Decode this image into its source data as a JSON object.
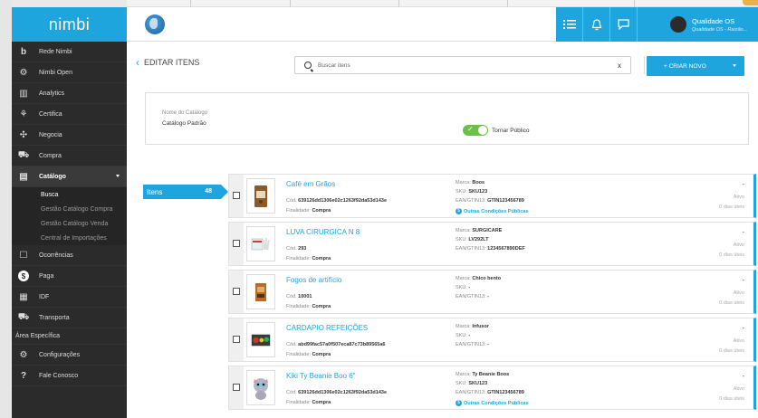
{
  "brand": "nimbi",
  "sidebar": {
    "items": [
      {
        "icon": "nimbi-b-icon",
        "glyph": "b",
        "label": "Rede Nimbi"
      },
      {
        "icon": "gear-icon",
        "glyph": "⚙",
        "label": "Nimbi Open"
      },
      {
        "icon": "analytics-icon",
        "glyph": "▥",
        "label": "Analytics"
      },
      {
        "icon": "certifica-icon",
        "glyph": "⚘",
        "label": "Certifica"
      },
      {
        "icon": "negocia-icon",
        "glyph": "✣",
        "label": "Negocia"
      },
      {
        "icon": "cart-icon",
        "glyph": "⛟",
        "label": "Compra"
      }
    ],
    "catalog": {
      "label": "Catálogo",
      "icon": "books-icon",
      "glyph": "▤"
    },
    "sub_items": [
      "Busca",
      "Gestão Catálogo Compra",
      "Gestão Catálogo Venda",
      "Central de Importações"
    ],
    "items2": [
      {
        "icon": "ocorrencias-icon",
        "glyph": "☐",
        "label": "Ocorrências"
      },
      {
        "icon": "dollar-icon",
        "glyph": "$",
        "label": "Paga"
      },
      {
        "icon": "idf-icon",
        "glyph": "▦",
        "label": "IDF"
      },
      {
        "icon": "truck-icon",
        "glyph": "⛟",
        "label": "Transporta"
      }
    ],
    "area_label": "Área Específica",
    "items3": [
      {
        "icon": "settings-icon",
        "glyph": "⚙",
        "label": "Configurações"
      },
      {
        "icon": "question-icon",
        "glyph": "?",
        "label": "Fale Conosco"
      }
    ]
  },
  "header": {
    "user_name": "Qualidade OS",
    "user_sub": "Qualidade OS - Raizão..."
  },
  "main": {
    "back_label": "EDITAR ITENS",
    "search_placeholder": "Buscar itens",
    "search_clear": "x",
    "new_button": "+ CRIAR NOVO",
    "catalog_label": "Nome do Catálogo",
    "catalog_value": "Catálogo Padrão",
    "toggle_label": "Tornar Público",
    "tab_label": "Itens",
    "tab_count": "48"
  },
  "labels": {
    "cod": "Cód.",
    "finalidade": "Finalidade:",
    "marca": "Marca:",
    "sku": "SKU:",
    "ean": "EAN/GTIN13:",
    "outras": "Outras Condições Públicas",
    "status": "Ativo",
    "days": "0 dias úteis",
    "dash": "-"
  },
  "products": [
    {
      "name": "Café em Grãos",
      "code": "639126dd1306e02c1263f92da53d143e",
      "finalidade": "Compra",
      "marca": "Boos",
      "sku": "SKU123",
      "ean": "GTIN123456789",
      "outras": true,
      "thumb": "coffee"
    },
    {
      "name": "LUVA CIRURGICA N 8",
      "code": "293",
      "finalidade": "Compra",
      "marca": "SURGICARE",
      "sku": "LV292LT",
      "ean": "1234567890DEF",
      "outras": false,
      "thumb": "gloves"
    },
    {
      "name": "Fogos de artifício",
      "code": "10001",
      "finalidade": "Compra",
      "marca": "Chico bento",
      "sku": "-",
      "ean": "-",
      "outras": false,
      "thumb": "fireworks"
    },
    {
      "name": "CARDAPIO REFEIÇÕES",
      "code": "abd99fac57a0f507eca87c73b89565a6",
      "finalidade": "Compra",
      "marca": "Infusor",
      "sku": "-",
      "ean": "-",
      "outras": false,
      "thumb": "menu"
    },
    {
      "name": "Kiki Ty Beanie Boo 6\"",
      "code": "639126dd1306e02c1263f92da53d143e",
      "finalidade": "Compra",
      "marca": "Ty Beanie Boos",
      "sku": "SKU123",
      "ean": "GTIN123456789",
      "outras": true,
      "thumb": "plush"
    }
  ],
  "colors": {
    "accent": "#1ea5de",
    "sidebar": "#2b2b2b",
    "toggle": "#6cc04a"
  }
}
